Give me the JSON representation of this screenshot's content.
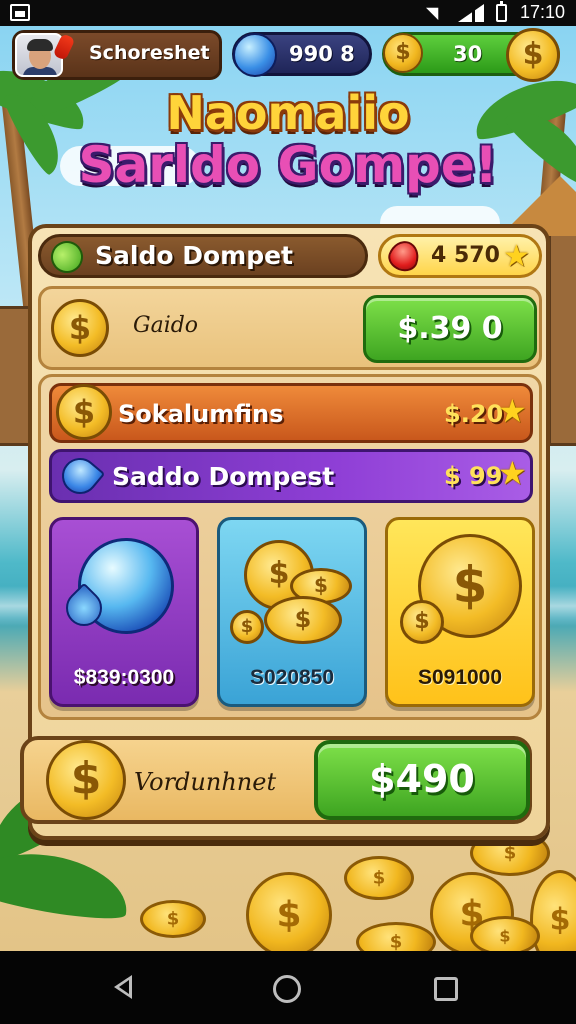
{
  "status_bar": {
    "time": "17:10"
  },
  "hud": {
    "player_name": "Schoreshet",
    "gems": "990 8",
    "coins": "30",
    "coin_symbol": "$"
  },
  "title": {
    "line1": "Naomaiio",
    "line2": "Sarldo Gompe!"
  },
  "panel": {
    "header_title": "Saldo Dompet",
    "header_gems": "4 570",
    "balance": {
      "label": "Gaido",
      "value": "$.39 0"
    },
    "offers": [
      {
        "label": "Sokalumfins",
        "value": "$.20"
      },
      {
        "label": "Saddo Dompest",
        "value": "$ 99"
      }
    ],
    "cards": [
      {
        "label": "$839:0300",
        "icon": "crystal-orb-icon"
      },
      {
        "label": "S020850",
        "icon": "coin-stack-icon"
      },
      {
        "label": "S091000",
        "icon": "gold-coin-icon"
      }
    ],
    "bottom": {
      "label": "Vordunhnet",
      "button": "$490"
    }
  },
  "colors": {
    "accent_green": "#3ea521",
    "panel_bg": "#f7e3b5",
    "panel_border": "#6b4318",
    "orange_row": "#c9581c",
    "purple_row": "#8f3fd6",
    "title_yellow": "#ffd43a"
  }
}
